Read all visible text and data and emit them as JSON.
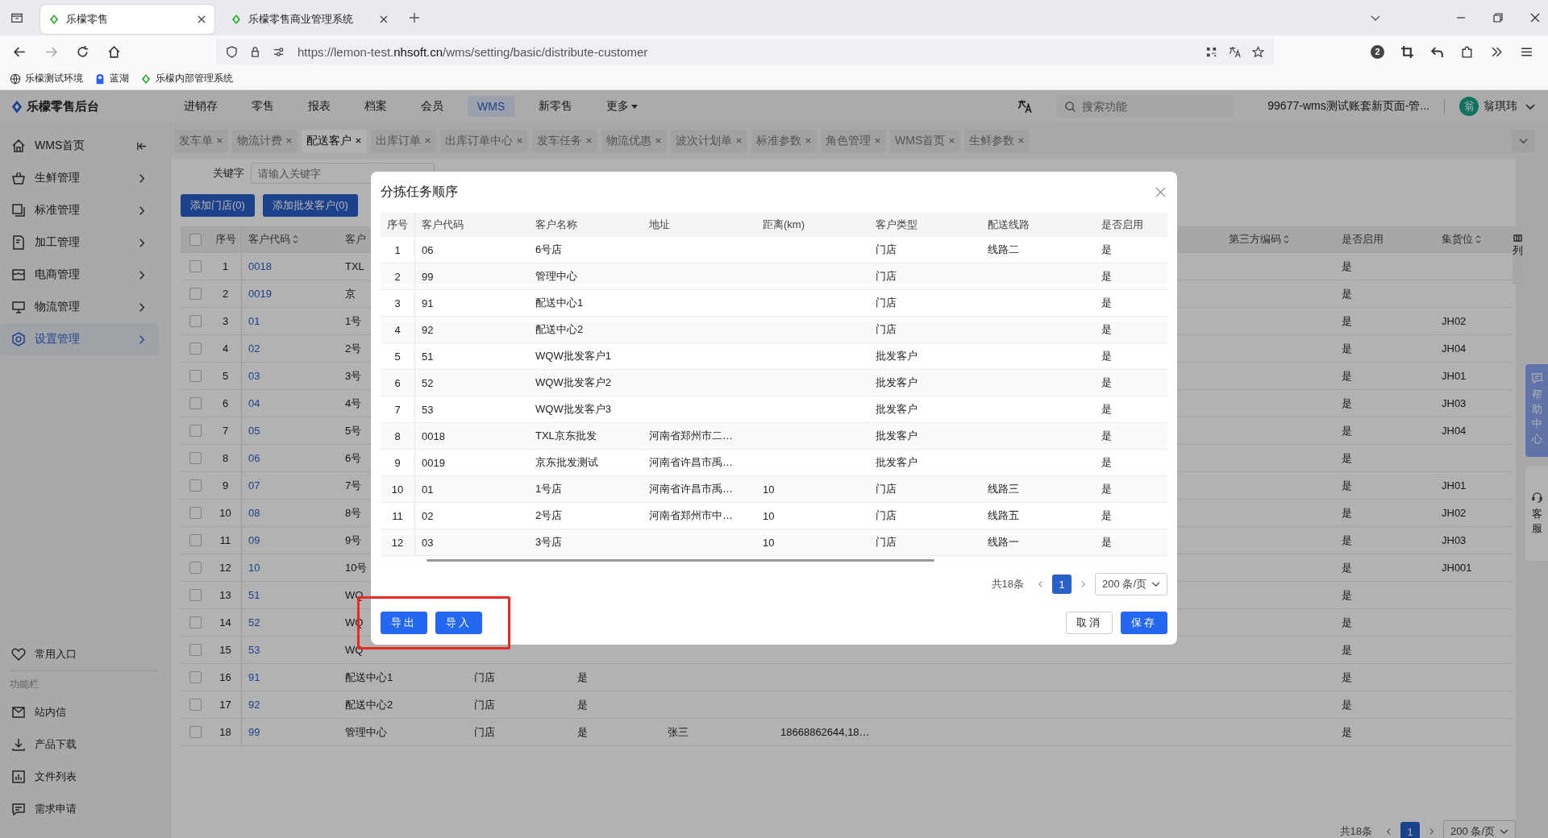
{
  "browser": {
    "tabs": [
      {
        "title": "乐檬零售",
        "selected": true
      },
      {
        "title": "乐檬零售商业管理系统",
        "selected": false
      }
    ],
    "url_prefix": "https://lemon-test.",
    "url_domain": "nhsoft.cn",
    "url_path": "/wms/setting/basic/distribute-customer",
    "extension_badge": "2",
    "bookmarks": [
      "乐檬测试环境",
      "蓝湖",
      "乐檬内部管理系统"
    ]
  },
  "app": {
    "logo": "乐檬零售后台",
    "nav": [
      {
        "label": "进销存",
        "selected": false,
        "has_menu": false
      },
      {
        "label": "零售",
        "selected": false,
        "has_menu": false
      },
      {
        "label": "报表",
        "selected": false,
        "has_menu": false
      },
      {
        "label": "档案",
        "selected": false,
        "has_menu": false
      },
      {
        "label": "会员",
        "selected": false,
        "has_menu": false
      },
      {
        "label": "WMS",
        "selected": true,
        "has_menu": false
      },
      {
        "label": "新零售",
        "selected": false,
        "has_menu": false
      },
      {
        "label": "更多",
        "selected": false,
        "has_menu": true
      }
    ],
    "search": {
      "placeholder": "搜索功能"
    },
    "account": "99677-wms测试账套新页面-管...",
    "user": {
      "avatar": "翁",
      "name": "翁琪玮"
    }
  },
  "page_tabs": [
    {
      "label": "发车单",
      "selected": false
    },
    {
      "label": "物流计费",
      "selected": false
    },
    {
      "label": "配送客户",
      "selected": true
    },
    {
      "label": "出库订单",
      "selected": false
    },
    {
      "label": "出库订单中心",
      "selected": false
    },
    {
      "label": "发车任务",
      "selected": false
    },
    {
      "label": "物流优惠",
      "selected": false
    },
    {
      "label": "波次计划单",
      "selected": false
    },
    {
      "label": "标准参数",
      "selected": false
    },
    {
      "label": "角色管理",
      "selected": false
    },
    {
      "label": "WMS首页",
      "selected": false
    },
    {
      "label": "生鲜参数",
      "selected": false
    }
  ],
  "sidebar": {
    "items": [
      {
        "label": "WMS首页",
        "kind": "home",
        "selected": false
      },
      {
        "label": "生鲜管理",
        "kind": "group",
        "selected": false
      },
      {
        "label": "标准管理",
        "kind": "group",
        "selected": false
      },
      {
        "label": "加工管理",
        "kind": "group",
        "selected": false
      },
      {
        "label": "电商管理",
        "kind": "group",
        "selected": false
      },
      {
        "label": "物流管理",
        "kind": "group",
        "selected": false
      },
      {
        "label": "设置管理",
        "kind": "group",
        "selected": true
      }
    ],
    "favorites": "常用入口",
    "section_title": "功能栏",
    "tools": [
      "站内信",
      "产品下载",
      "文件列表",
      "需求申请"
    ]
  },
  "filter": {
    "label": "关键字",
    "placeholder": "请输入关键字"
  },
  "actions": [
    "添加门店(0)",
    "添加批发客户(0)"
  ],
  "table": {
    "all_checked": false,
    "columns": [
      {
        "label": "序号",
        "sortable": false
      },
      {
        "label": "客户代码",
        "sortable": true
      },
      {
        "label": "客户",
        "sortable": false
      },
      {
        "label": "第三方编码",
        "sortable": true
      },
      {
        "label": "是否启用",
        "sortable": false
      },
      {
        "label": "集货位",
        "sortable": true
      }
    ],
    "rows": [
      {
        "checked": false,
        "seq": "1",
        "code": "0018",
        "name": "TXL",
        "en2": "是"
      },
      {
        "checked": false,
        "seq": "2",
        "code": "0019",
        "name": "京",
        "en2": "是"
      },
      {
        "checked": false,
        "seq": "3",
        "code": "01",
        "name": "1号",
        "en2": "是",
        "slot": "JH02"
      },
      {
        "checked": false,
        "seq": "4",
        "code": "02",
        "name": "2号",
        "en2": "是",
        "slot": "JH04"
      },
      {
        "checked": false,
        "seq": "5",
        "code": "03",
        "name": "3号",
        "en2": "是",
        "slot": "JH01"
      },
      {
        "checked": false,
        "seq": "6",
        "code": "04",
        "name": "4号",
        "en2": "是",
        "slot": "JH03"
      },
      {
        "checked": false,
        "seq": "7",
        "code": "05",
        "name": "5号",
        "en2": "是",
        "slot": "JH04"
      },
      {
        "checked": false,
        "seq": "8",
        "code": "06",
        "name": "6号",
        "en2": "是"
      },
      {
        "checked": false,
        "seq": "9",
        "code": "07",
        "name": "7号",
        "en2": "是",
        "slot": "JH01"
      },
      {
        "checked": false,
        "seq": "10",
        "code": "08",
        "name": "8号",
        "en2": "是",
        "slot": "JH02"
      },
      {
        "checked": false,
        "seq": "11",
        "code": "09",
        "name": "9号",
        "en2": "是",
        "slot": "JH03"
      },
      {
        "checked": false,
        "seq": "12",
        "code": "10",
        "name": "10号",
        "en2": "是",
        "slot": "JH001"
      },
      {
        "checked": false,
        "seq": "13",
        "code": "51",
        "name": "WQ",
        "en2": "是"
      },
      {
        "checked": false,
        "seq": "14",
        "code": "52",
        "name": "WQ",
        "en2": "是"
      },
      {
        "checked": false,
        "seq": "15",
        "code": "53",
        "name": "WQ",
        "en2": "是"
      },
      {
        "checked": false,
        "seq": "16",
        "code": "91",
        "name": "配送中心1",
        "type": "门店",
        "en": "是",
        "en2": "是"
      },
      {
        "checked": false,
        "seq": "17",
        "code": "92",
        "name": "配送中心2",
        "type": "门店",
        "en": "是",
        "en2": "是"
      },
      {
        "checked": false,
        "seq": "18",
        "code": "99",
        "name": "管理中心",
        "type": "门店",
        "en": "是",
        "contact": "张三",
        "phone": "18668862644,18…",
        "en2": "是"
      }
    ]
  },
  "column_settings": "列",
  "pagination": {
    "total": "共18条",
    "page": "1",
    "page_size": "200 条/页"
  },
  "side_tabs": [
    {
      "kind": "help",
      "label": "帮助中心"
    },
    {
      "kind": "service",
      "label": "客服"
    }
  ],
  "modal": {
    "title": "分拣任务顺序",
    "highlighted": true,
    "columns": [
      "序号",
      "客户代码",
      "客户名称",
      "地址",
      "距离(km)",
      "客户类型",
      "配送线路",
      "是否启用"
    ],
    "rows": [
      {
        "seq": "1",
        "code": "06",
        "name": "6号店",
        "type": "门店",
        "route": "线路二",
        "enabled": "是"
      },
      {
        "seq": "2",
        "code": "99",
        "name": "管理中心",
        "type": "门店",
        "enabled": "是"
      },
      {
        "seq": "3",
        "code": "91",
        "name": "配送中心1",
        "type": "门店",
        "enabled": "是"
      },
      {
        "seq": "4",
        "code": "92",
        "name": "配送中心2",
        "type": "门店",
        "enabled": "是"
      },
      {
        "seq": "5",
        "code": "51",
        "name": "WQW批发客户1",
        "type": "批发客户",
        "enabled": "是"
      },
      {
        "seq": "6",
        "code": "52",
        "name": "WQW批发客户2",
        "type": "批发客户",
        "enabled": "是"
      },
      {
        "seq": "7",
        "code": "53",
        "name": "WQW批发客户3",
        "type": "批发客户",
        "enabled": "是"
      },
      {
        "seq": "8",
        "code": "0018",
        "name": "TXL京东批发",
        "address": "河南省郑州市二…",
        "type": "批发客户",
        "enabled": "是"
      },
      {
        "seq": "9",
        "code": "0019",
        "name": "京东批发测试",
        "address": "河南省许昌市禹…",
        "type": "批发客户",
        "enabled": "是"
      },
      {
        "seq": "10",
        "code": "01",
        "name": "1号店",
        "address": "河南省许昌市禹…",
        "distance": "10",
        "type": "门店",
        "route": "线路三",
        "enabled": "是"
      },
      {
        "seq": "11",
        "code": "02",
        "name": "2号店",
        "address": "河南省郑州市中…",
        "distance": "10",
        "type": "门店",
        "route": "线路五",
        "enabled": "是"
      },
      {
        "seq": "12",
        "code": "03",
        "name": "3号店",
        "distance": "10",
        "type": "门店",
        "route": "线路一",
        "enabled": "是"
      }
    ],
    "pagination": {
      "total": "共18条",
      "page": "1",
      "page_size": "200 条/页"
    },
    "left_buttons": [
      "导出",
      "导入"
    ],
    "right_buttons": [
      {
        "label": "取消",
        "primary": false
      },
      {
        "label": "保存",
        "primary": true
      }
    ]
  }
}
